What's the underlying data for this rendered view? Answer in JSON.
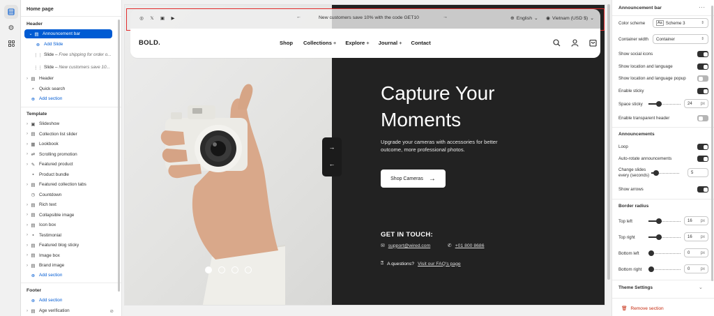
{
  "rail": {
    "items": [
      "sections-icon",
      "settings-gear-icon",
      "apps-icon"
    ]
  },
  "left_panel": {
    "page_title": "Home page",
    "header_group": "Header",
    "header_items": [
      {
        "label": "Announcement bar",
        "selected": true,
        "icon": "announcement-bar-icon"
      },
      {
        "label": "Add Slide",
        "type": "add"
      },
      {
        "label": "Slide",
        "sub": "Free shipping for order o..."
      },
      {
        "label": "Slide",
        "sub": "New customers save 10..."
      },
      {
        "label": "Header",
        "icon": "header-icon"
      },
      {
        "label": "Quick search",
        "icon": "search-icon"
      },
      {
        "label": "Add section",
        "type": "add"
      }
    ],
    "template_group": "Template",
    "template_items": [
      "Slideshow",
      "Collection list slider",
      "Lookbook",
      "Scrolling promotion",
      "Featured product",
      "Product bundle",
      "Featured collection tabs",
      "Countdown",
      "Rich text",
      "Collapsible image",
      "Icon box",
      "Testimonial",
      "Featured blog sticky",
      "Image box",
      "Brand image"
    ],
    "template_add": "Add section",
    "footer_group": "Footer",
    "footer_add": "Add section",
    "footer_items": [
      "Age verification"
    ]
  },
  "preview": {
    "announcement": {
      "message": "New customers save 10% with the code GET10",
      "language": "English",
      "currency": "Vietnam  (USD $)",
      "social": [
        "instagram-icon",
        "x-icon",
        "instagram-square-icon",
        "youtube-icon"
      ]
    },
    "nav": {
      "logo": "BOLD.",
      "menu": [
        {
          "label": "Shop",
          "plus": ""
        },
        {
          "label": "Collections",
          "plus": "+"
        },
        {
          "label": "Explore",
          "plus": "+"
        },
        {
          "label": "Journal",
          "plus": "+"
        },
        {
          "label": "Contact",
          "plus": ""
        }
      ]
    },
    "hero": {
      "heading_line1": "Capture Your",
      "heading_line2": "Moments",
      "subtext": "Upgrade your cameras with accessories for better outcome, more professional photos.",
      "button": "Shop Cameras",
      "contact_title": "GET IN TOUCH:",
      "email": "support@wired.com",
      "phone": "+01 800 8686",
      "faq_prefix": "A questions?",
      "faq_link": "Visit our FAQ's page",
      "active_dot": 1,
      "dot_count": 4
    }
  },
  "right_panel": {
    "title": "Announcement bar",
    "color_scheme_label": "Color scheme",
    "color_scheme_value": "Scheme 3",
    "container_width_label": "Container width",
    "container_width_value": "Container",
    "toggles1": [
      {
        "label": "Show social icons",
        "on": true
      },
      {
        "label": "Show location and language",
        "on": true
      },
      {
        "label": "Show location and language popup",
        "on": false
      },
      {
        "label": "Enable sticky",
        "on": true
      }
    ],
    "space_sticky_label": "Space sticky",
    "space_sticky_value": "24",
    "space_sticky_unit": "px",
    "space_sticky_fraction": 0.3,
    "transparent_label": "Enable transparent header",
    "transparent_on": false,
    "announcements_title": "Announcements",
    "loop_label": "Loop",
    "loop_on": true,
    "autorotate_label": "Auto-rotate announcements",
    "autorotate_on": true,
    "change_slides_label_1": "Change slides",
    "change_slides_label_2": "every (seconds)",
    "change_slides_value": "5",
    "change_slides_fraction": 0.1,
    "show_arrows_label": "Show arrows",
    "show_arrows_on": true,
    "border_radius_title": "Border radius",
    "radius": [
      {
        "label": "Top left",
        "value": "16",
        "fraction": 0.3
      },
      {
        "label": "Top right",
        "value": "16",
        "fraction": 0.3
      },
      {
        "label": "Bottom left",
        "value": "0",
        "fraction": 0.0
      },
      {
        "label": "Bottom right",
        "value": "0",
        "fraction": 0.0
      }
    ],
    "unit": "px",
    "theme_settings": "Theme Settings",
    "remove_section": "Remove section"
  }
}
